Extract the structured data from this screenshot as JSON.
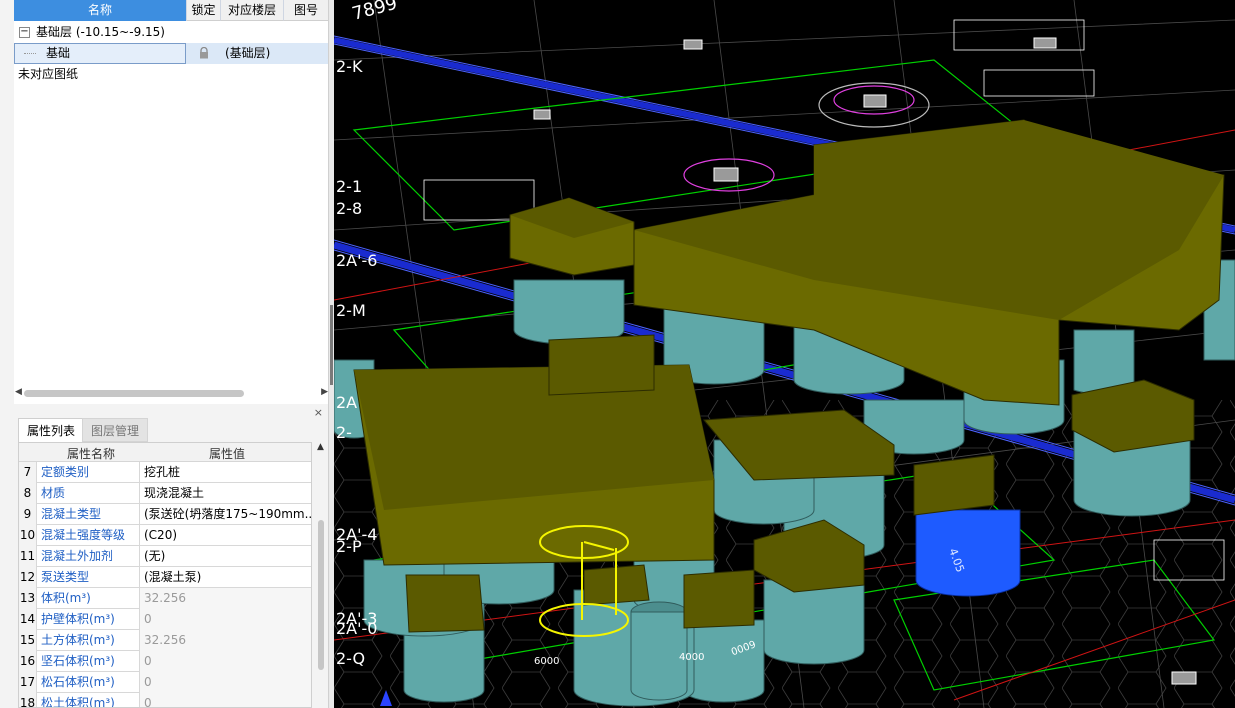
{
  "floor_panel": {
    "headers": {
      "name": "名称",
      "lock": "锁定",
      "floor": "对应楼层",
      "sheet": "图号"
    },
    "group": {
      "toggle": "−",
      "label": "基础层 (-10.15~-9.15)"
    },
    "selected_item": {
      "name": "基础",
      "floor": "(基础层)"
    },
    "unmatched_label": "未对应图纸"
  },
  "prop_panel": {
    "close": "×",
    "tabs": [
      "属性列表",
      "图层管理"
    ],
    "columns": {
      "name": "属性名称",
      "value": "属性值"
    },
    "rows": [
      {
        "num": "7",
        "name": "定额类别",
        "value": "挖孔桩",
        "readonly": false
      },
      {
        "num": "8",
        "name": "材质",
        "value": "现浇混凝土",
        "readonly": false
      },
      {
        "num": "9",
        "name": "混凝土类型",
        "value": "(泵送砼(坍落度175~190mm...",
        "readonly": false
      },
      {
        "num": "10",
        "name": "混凝土强度等级",
        "value": "(C20)",
        "readonly": false
      },
      {
        "num": "11",
        "name": "混凝土外加剂",
        "value": "(无)",
        "readonly": false
      },
      {
        "num": "12",
        "name": "泵送类型",
        "value": "(混凝土泵)",
        "readonly": false
      },
      {
        "num": "13",
        "name": "体积(m³)",
        "value": "32.256",
        "readonly": true
      },
      {
        "num": "14",
        "name": "护壁体积(m³)",
        "value": "0",
        "readonly": true
      },
      {
        "num": "15",
        "name": "土方体积(m³)",
        "value": "32.256",
        "readonly": true
      },
      {
        "num": "16",
        "name": "坚石体积(m³)",
        "value": "0",
        "readonly": true
      },
      {
        "num": "17",
        "name": "松石体积(m³)",
        "value": "0",
        "readonly": true
      },
      {
        "num": "18",
        "name": "松土体积(m³)",
        "value": "0",
        "readonly": true
      }
    ]
  },
  "viewport": {
    "axis_labels": [
      "7899",
      "2-K",
      "2-1",
      "2-8",
      "2A'-6",
      "2-M",
      "2A",
      "2-",
      "2A'-4",
      "2-P",
      "2A'-3",
      "2A'-0",
      "2-Q"
    ],
    "dim_labels": [
      "6000",
      "4000",
      "6000"
    ],
    "selected_dim": "4.05",
    "colors": {
      "background": "#000000",
      "cap": "#5b5a00",
      "pile": "#5fa8a8",
      "selected_pile": "#1e5bff",
      "outline": "#f5f500",
      "grid_line": "#00d000",
      "axis_text": "#ffffff"
    }
  }
}
